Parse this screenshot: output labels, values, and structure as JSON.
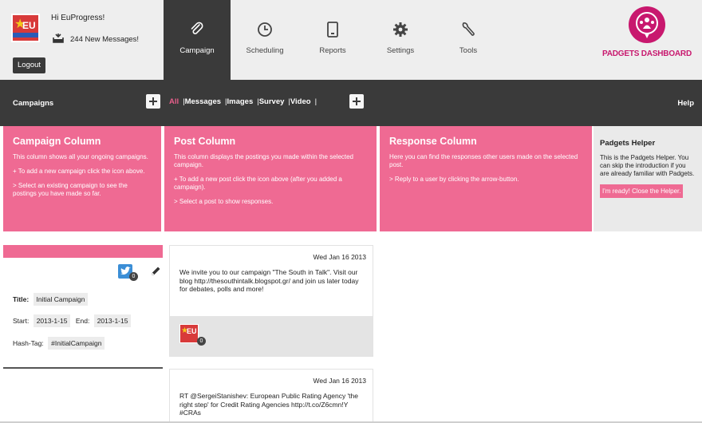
{
  "header": {
    "greeting": "Hi EuProgress!",
    "messages": "244 New Messages!",
    "logout": "Logout",
    "avatar_text": "EU",
    "nav": [
      {
        "label": "Campaign",
        "icon": "paperclip-icon",
        "active": true
      },
      {
        "label": "Scheduling",
        "icon": "clock-icon"
      },
      {
        "label": "Reports",
        "icon": "tablet-icon"
      },
      {
        "label": "Settings",
        "icon": "gear-icon"
      },
      {
        "label": "Tools",
        "icon": "wrench-icon"
      }
    ],
    "brand": "PADGETS DASHBOARD",
    "brand_color": "#c8186e"
  },
  "toolbar": {
    "campaigns": "Campaigns",
    "filters": [
      "All",
      "Messages",
      "Images",
      "Survey",
      "Video"
    ],
    "selected_filter": "All",
    "help": "Help"
  },
  "helper_columns": {
    "campaign": {
      "title": "Campaign Column",
      "p1": "This column shows all your ongoing campaigns.",
      "p2": "+ To add a new campaign click the icon above.",
      "p3": "> Select an existing campaign to see the postings you have made so far."
    },
    "post": {
      "title": "Post Column",
      "p1": "This column displays the postings you made within the selected campaign.",
      "p2": "+ To add a new post click the icon above (after you added a campaign).",
      "p3": "> Select a post to show responses."
    },
    "response": {
      "title": "Response Column",
      "p1": "Here you can find the responses other users made on the selected post.",
      "p2": "> Reply to a user by clicking the arrow-button."
    },
    "helper": {
      "title": "Padgets Helper",
      "text": "This is the Padgets Helper. You can skip the introduction if you are already familiar with Padgets.",
      "button": "I'm ready! Close the Helper."
    }
  },
  "campaign": {
    "twitter_count": "0",
    "title_label": "Title:",
    "title": "Initial Campaign",
    "start_label": "Start:",
    "start": "2013-1-15",
    "end_label": "End:",
    "end": "2013-1-15",
    "hashtag_label": "Hash-Tag:",
    "hashtag": "#InitialCampaign"
  },
  "posts": [
    {
      "date": "Wed Jan 16 2013",
      "text": "We invite you to our campaign \"The South in Talk\". Visit our blog http://thesouthintalk.blogspot.gr/ and join us later today for debates, polls and more!",
      "responses": "0"
    },
    {
      "date": "Wed Jan 16 2013",
      "text": "RT @SergeiStanishev: European Public Rating Agency 'the right step' for Credit Rating Agencies http://t.co/Z6cmn!Y #CRAs"
    }
  ],
  "colors": {
    "pink": "#ef6a93",
    "dark": "#3a3a3a"
  }
}
